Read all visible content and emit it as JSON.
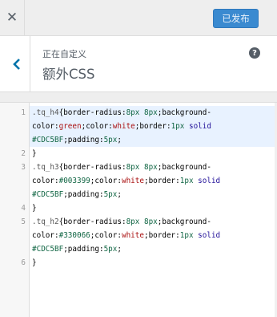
{
  "header": {
    "close_symbol": "✕",
    "publish_label": "已发布"
  },
  "section": {
    "customizing_label": "正在自定义",
    "title": "额外CSS",
    "help_symbol": "?"
  },
  "editor": {
    "line_numbers": [
      "1",
      "2",
      "3",
      "4",
      "5",
      "6"
    ],
    "lines": [
      ".tq_h4{border-radius:8px 8px;background-",
      "color:green;color:white;border:1px solid",
      "#CDC5BF;padding:5px;",
      "}",
      ".tq_h3{border-radius:8px 8px;background-",
      "color:#003399;color:white;border:1px solid",
      "#CDC5BF;padding:5px;",
      "}",
      ".tq_h2{border-radius:8px 8px;background-",
      "color:#330066;color:white;border:1px solid",
      "#CDC5BF;padding:5px;",
      "}"
    ]
  },
  "colors": {
    "accent": "#3a8ad0",
    "active_line": "#e8f2ff",
    "text": "#555d66"
  }
}
